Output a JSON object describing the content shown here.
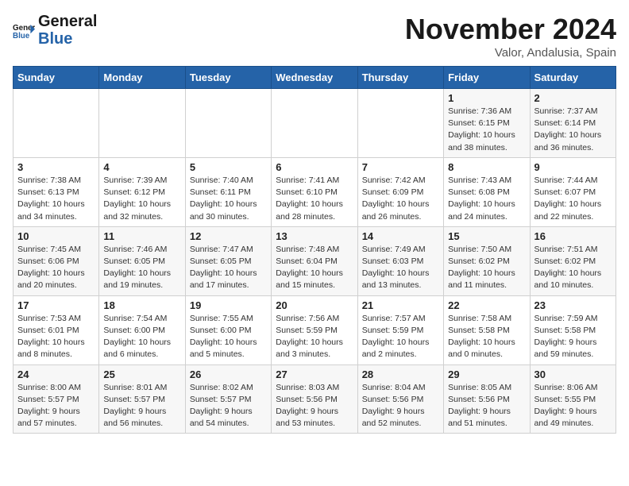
{
  "logo": {
    "line1": "General",
    "line2": "Blue"
  },
  "header": {
    "month": "November 2024",
    "location": "Valor, Andalusia, Spain"
  },
  "days_of_week": [
    "Sunday",
    "Monday",
    "Tuesday",
    "Wednesday",
    "Thursday",
    "Friday",
    "Saturday"
  ],
  "weeks": [
    [
      {
        "day": "",
        "info": ""
      },
      {
        "day": "",
        "info": ""
      },
      {
        "day": "",
        "info": ""
      },
      {
        "day": "",
        "info": ""
      },
      {
        "day": "",
        "info": ""
      },
      {
        "day": "1",
        "info": "Sunrise: 7:36 AM\nSunset: 6:15 PM\nDaylight: 10 hours\nand 38 minutes."
      },
      {
        "day": "2",
        "info": "Sunrise: 7:37 AM\nSunset: 6:14 PM\nDaylight: 10 hours\nand 36 minutes."
      }
    ],
    [
      {
        "day": "3",
        "info": "Sunrise: 7:38 AM\nSunset: 6:13 PM\nDaylight: 10 hours\nand 34 minutes."
      },
      {
        "day": "4",
        "info": "Sunrise: 7:39 AM\nSunset: 6:12 PM\nDaylight: 10 hours\nand 32 minutes."
      },
      {
        "day": "5",
        "info": "Sunrise: 7:40 AM\nSunset: 6:11 PM\nDaylight: 10 hours\nand 30 minutes."
      },
      {
        "day": "6",
        "info": "Sunrise: 7:41 AM\nSunset: 6:10 PM\nDaylight: 10 hours\nand 28 minutes."
      },
      {
        "day": "7",
        "info": "Sunrise: 7:42 AM\nSunset: 6:09 PM\nDaylight: 10 hours\nand 26 minutes."
      },
      {
        "day": "8",
        "info": "Sunrise: 7:43 AM\nSunset: 6:08 PM\nDaylight: 10 hours\nand 24 minutes."
      },
      {
        "day": "9",
        "info": "Sunrise: 7:44 AM\nSunset: 6:07 PM\nDaylight: 10 hours\nand 22 minutes."
      }
    ],
    [
      {
        "day": "10",
        "info": "Sunrise: 7:45 AM\nSunset: 6:06 PM\nDaylight: 10 hours\nand 20 minutes."
      },
      {
        "day": "11",
        "info": "Sunrise: 7:46 AM\nSunset: 6:05 PM\nDaylight: 10 hours\nand 19 minutes."
      },
      {
        "day": "12",
        "info": "Sunrise: 7:47 AM\nSunset: 6:05 PM\nDaylight: 10 hours\nand 17 minutes."
      },
      {
        "day": "13",
        "info": "Sunrise: 7:48 AM\nSunset: 6:04 PM\nDaylight: 10 hours\nand 15 minutes."
      },
      {
        "day": "14",
        "info": "Sunrise: 7:49 AM\nSunset: 6:03 PM\nDaylight: 10 hours\nand 13 minutes."
      },
      {
        "day": "15",
        "info": "Sunrise: 7:50 AM\nSunset: 6:02 PM\nDaylight: 10 hours\nand 11 minutes."
      },
      {
        "day": "16",
        "info": "Sunrise: 7:51 AM\nSunset: 6:02 PM\nDaylight: 10 hours\nand 10 minutes."
      }
    ],
    [
      {
        "day": "17",
        "info": "Sunrise: 7:53 AM\nSunset: 6:01 PM\nDaylight: 10 hours\nand 8 minutes."
      },
      {
        "day": "18",
        "info": "Sunrise: 7:54 AM\nSunset: 6:00 PM\nDaylight: 10 hours\nand 6 minutes."
      },
      {
        "day": "19",
        "info": "Sunrise: 7:55 AM\nSunset: 6:00 PM\nDaylight: 10 hours\nand 5 minutes."
      },
      {
        "day": "20",
        "info": "Sunrise: 7:56 AM\nSunset: 5:59 PM\nDaylight: 10 hours\nand 3 minutes."
      },
      {
        "day": "21",
        "info": "Sunrise: 7:57 AM\nSunset: 5:59 PM\nDaylight: 10 hours\nand 2 minutes."
      },
      {
        "day": "22",
        "info": "Sunrise: 7:58 AM\nSunset: 5:58 PM\nDaylight: 10 hours\nand 0 minutes."
      },
      {
        "day": "23",
        "info": "Sunrise: 7:59 AM\nSunset: 5:58 PM\nDaylight: 9 hours\nand 59 minutes."
      }
    ],
    [
      {
        "day": "24",
        "info": "Sunrise: 8:00 AM\nSunset: 5:57 PM\nDaylight: 9 hours\nand 57 minutes."
      },
      {
        "day": "25",
        "info": "Sunrise: 8:01 AM\nSunset: 5:57 PM\nDaylight: 9 hours\nand 56 minutes."
      },
      {
        "day": "26",
        "info": "Sunrise: 8:02 AM\nSunset: 5:57 PM\nDaylight: 9 hours\nand 54 minutes."
      },
      {
        "day": "27",
        "info": "Sunrise: 8:03 AM\nSunset: 5:56 PM\nDaylight: 9 hours\nand 53 minutes."
      },
      {
        "day": "28",
        "info": "Sunrise: 8:04 AM\nSunset: 5:56 PM\nDaylight: 9 hours\nand 52 minutes."
      },
      {
        "day": "29",
        "info": "Sunrise: 8:05 AM\nSunset: 5:56 PM\nDaylight: 9 hours\nand 51 minutes."
      },
      {
        "day": "30",
        "info": "Sunrise: 8:06 AM\nSunset: 5:55 PM\nDaylight: 9 hours\nand 49 minutes."
      }
    ]
  ]
}
